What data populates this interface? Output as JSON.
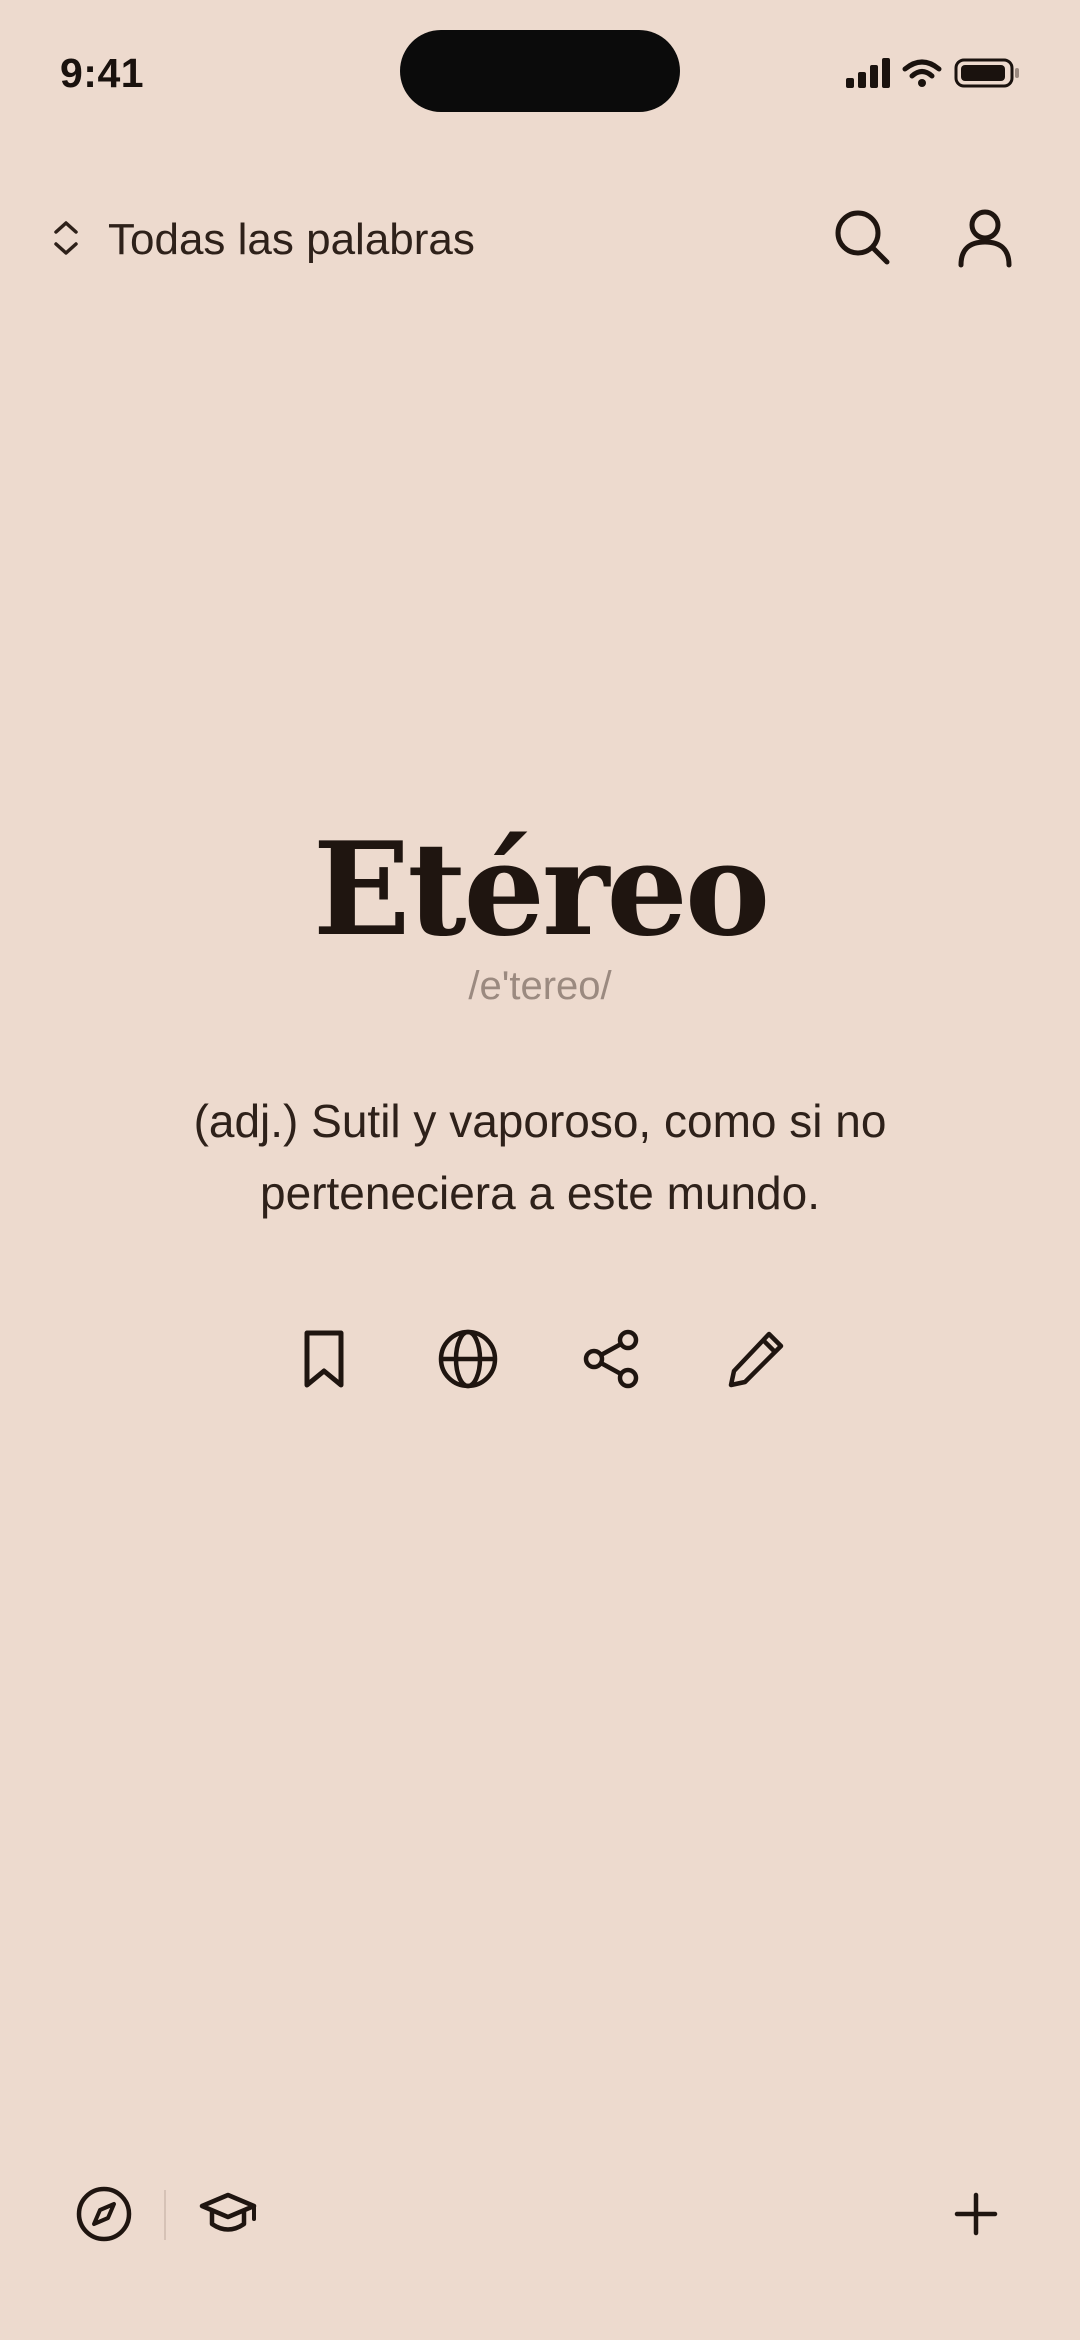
{
  "status_bar": {
    "time": "9:41",
    "icons": [
      "signal-icon",
      "wifi-icon",
      "battery-icon"
    ]
  },
  "header": {
    "filter_label": "Todas las palabras",
    "filter_icon": "chevron-up-down-icon",
    "search_icon": "search-icon",
    "profile_icon": "user-icon"
  },
  "entry": {
    "word": "Etéreo",
    "phonetic": "/e'tereo/",
    "definition": "(adj.) Sutil y vaporoso, como si no perteneciera a este mundo."
  },
  "actions": [
    {
      "icon": "bookmark-icon"
    },
    {
      "icon": "globe-icon"
    },
    {
      "icon": "share-icon"
    },
    {
      "icon": "pencil-icon"
    }
  ],
  "bottom_nav": {
    "items": [
      {
        "icon": "compass-icon"
      },
      {
        "icon": "graduation-cap-icon"
      },
      {
        "icon": "plus-icon"
      }
    ]
  },
  "colors": {
    "background": "#EDDACE",
    "text_primary": "#2A1D16",
    "text_muted": "#9B8A80"
  }
}
